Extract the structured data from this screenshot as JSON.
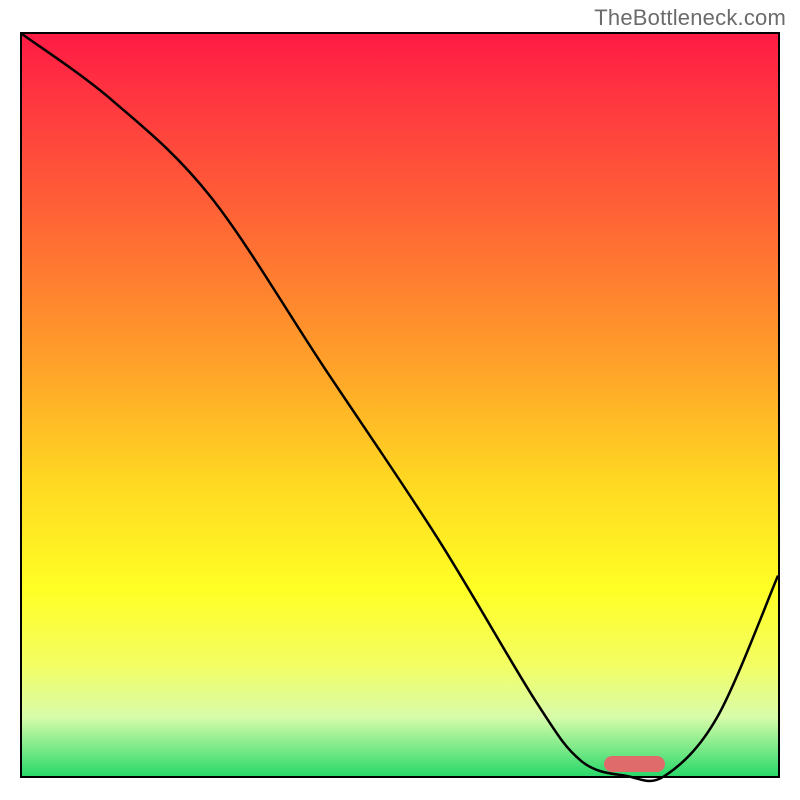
{
  "watermark": "TheBottleneck.com",
  "chart_data": {
    "type": "line",
    "title": "",
    "xlabel": "",
    "ylabel": "",
    "xlim": [
      0,
      100
    ],
    "ylim": [
      0,
      100
    ],
    "series": [
      {
        "name": "curve",
        "x": [
          0,
          12,
          25,
          40,
          55,
          68,
          74,
          80,
          85,
          92,
          100
        ],
        "values": [
          100,
          91,
          78,
          55,
          32,
          10,
          2,
          0,
          0,
          8,
          27
        ]
      }
    ],
    "marker": {
      "x_start": 77,
      "x_end": 85,
      "y": 0,
      "color": "#e06b6b"
    },
    "gradient_stops": [
      {
        "pos": 0,
        "color": "#ff1b45"
      },
      {
        "pos": 25,
        "color": "#ff6535"
      },
      {
        "pos": 60,
        "color": "#ffd722"
      },
      {
        "pos": 85,
        "color": "#f3fe63"
      },
      {
        "pos": 100,
        "color": "#2ad96a"
      }
    ]
  }
}
